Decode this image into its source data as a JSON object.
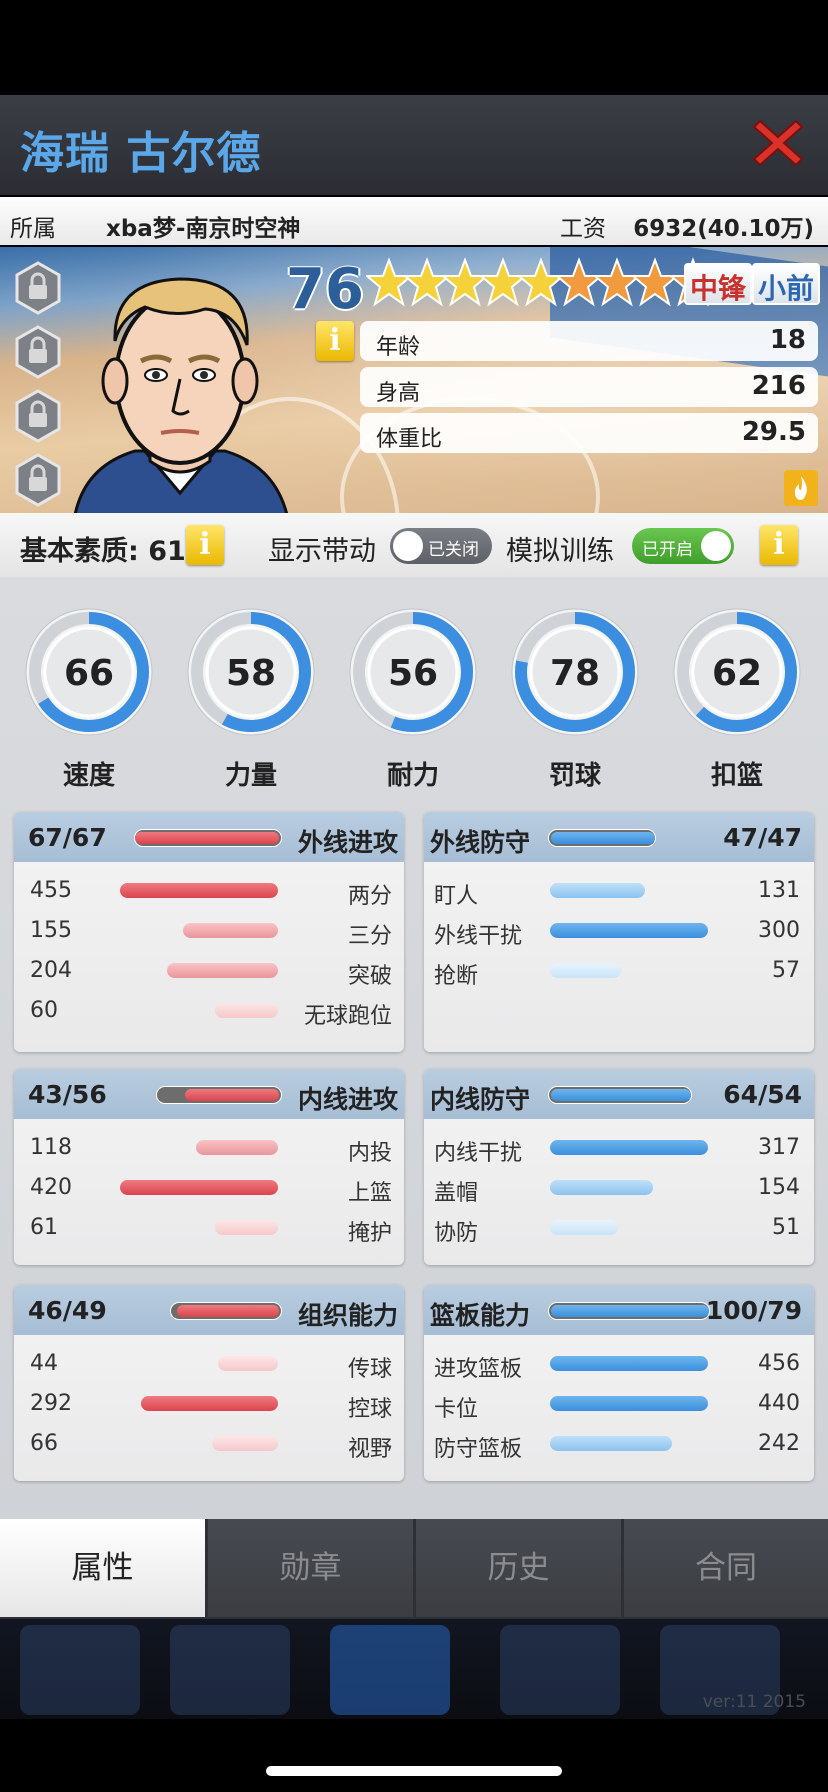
{
  "player": {
    "name": "海瑞 古尔德",
    "overall": "76",
    "stars_total": 9,
    "stars_gold": 5,
    "positions": [
      "中锋",
      "小前"
    ],
    "info_label": "所属",
    "team": "xba梦-南京时空神",
    "salary_label": "工资",
    "salary": "6932(40.10万)",
    "stats": [
      {
        "label": "年龄",
        "value": "18"
      },
      {
        "label": "身高",
        "value": "216"
      },
      {
        "label": "体重比",
        "value": "29.5"
      }
    ]
  },
  "toggles": {
    "base_quality": "基本素质: 61",
    "show_label": "显示带动",
    "show_state": "已关闭",
    "train_label": "模拟训练",
    "train_state": "已开启"
  },
  "rings": [
    {
      "value": "66",
      "label": "速度",
      "fill": 0.66
    },
    {
      "value": "58",
      "label": "力量",
      "fill": 0.58
    },
    {
      "value": "56",
      "label": "耐力",
      "fill": 0.56
    },
    {
      "value": "78",
      "label": "罚球",
      "fill": 0.78
    },
    {
      "value": "62",
      "label": "扣篮",
      "fill": 0.62
    }
  ],
  "cards": [
    {
      "title": "外线进攻",
      "score": "67/67",
      "side": "left",
      "bar": 1.0,
      "rows": [
        {
          "label": "两分",
          "value": "455",
          "fill": 1.0,
          "tone": "1"
        },
        {
          "label": "三分",
          "value": "155",
          "fill": 0.6,
          "tone": "2"
        },
        {
          "label": "突破",
          "value": "204",
          "fill": 0.7,
          "tone": "2"
        },
        {
          "label": "无球跑位",
          "value": "60",
          "fill": 0.4,
          "tone": "3"
        }
      ]
    },
    {
      "title": "外线防守",
      "score": "47/47",
      "side": "right",
      "bar": 1.0,
      "rows": [
        {
          "label": "盯人",
          "value": "131",
          "fill": 0.6,
          "tone": "2"
        },
        {
          "label": "外线干扰",
          "value": "300",
          "fill": 1.0,
          "tone": "1"
        },
        {
          "label": "抢断",
          "value": "57",
          "fill": 0.45,
          "tone": "3"
        }
      ]
    },
    {
      "title": "内线进攻",
      "score": "43/56",
      "side": "left",
      "bar": 0.77,
      "rows": [
        {
          "label": "内投",
          "value": "118",
          "fill": 0.52,
          "tone": "2"
        },
        {
          "label": "上篮",
          "value": "420",
          "fill": 1.0,
          "tone": "1"
        },
        {
          "label": "掩护",
          "value": "61",
          "fill": 0.4,
          "tone": "3"
        }
      ]
    },
    {
      "title": "内线防守",
      "score": "64/54",
      "side": "right",
      "bar": 1.0,
      "rows": [
        {
          "label": "内线干扰",
          "value": "317",
          "fill": 1.0,
          "tone": "1"
        },
        {
          "label": "盖帽",
          "value": "154",
          "fill": 0.65,
          "tone": "2"
        },
        {
          "label": "协防",
          "value": "51",
          "fill": 0.43,
          "tone": "3"
        }
      ]
    },
    {
      "title": "组织能力",
      "score": "46/49",
      "side": "left",
      "bar": 0.94,
      "rows": [
        {
          "label": "传球",
          "value": "44",
          "fill": 0.38,
          "tone": "3"
        },
        {
          "label": "控球",
          "value": "292",
          "fill": 0.87,
          "tone": "1"
        },
        {
          "label": "视野",
          "value": "66",
          "fill": 0.42,
          "tone": "3"
        }
      ]
    },
    {
      "title": "篮板能力",
      "score": "100/79",
      "side": "right",
      "bar": 1.0,
      "rows": [
        {
          "label": "进攻篮板",
          "value": "456",
          "fill": 1.0,
          "tone": "1"
        },
        {
          "label": "卡位",
          "value": "440",
          "fill": 1.0,
          "tone": "1"
        },
        {
          "label": "防守篮板",
          "value": "242",
          "fill": 0.77,
          "tone": "2"
        }
      ]
    }
  ],
  "tabs": [
    "属性",
    "勋章",
    "历史",
    "合同"
  ],
  "version": "ver:11  2015",
  "colors": {
    "accent_blue": "#3a8fdd",
    "accent_red": "#d9444d",
    "title_blue": "#5aa8ea",
    "ring_blue": "#3c8fe0"
  }
}
